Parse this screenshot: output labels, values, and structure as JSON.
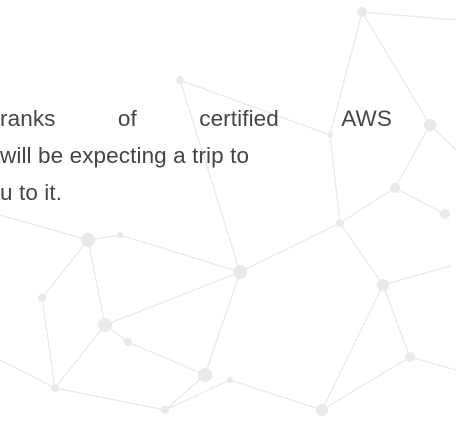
{
  "paragraph": {
    "line1_words": [
      "ranks",
      "of",
      "certified",
      "AWS"
    ],
    "line2": "will be expecting a trip to",
    "line3": "u to it."
  },
  "colors": {
    "background": "#ffffff",
    "text": "#454545",
    "network": "#e8e8e8"
  },
  "decoration": {
    "pattern": "network-lines-icon"
  }
}
